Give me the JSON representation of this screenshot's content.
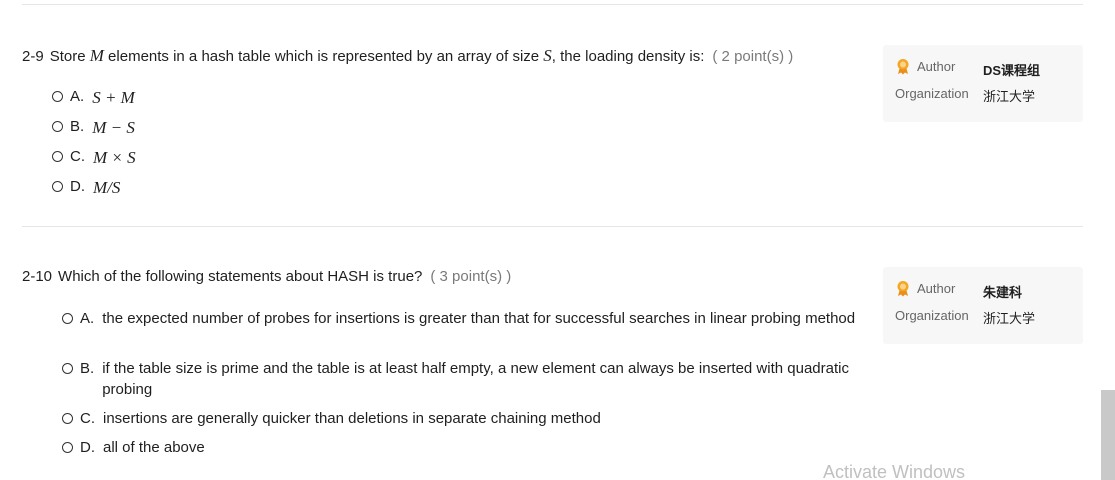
{
  "questions": [
    {
      "number": "2-9",
      "stem_before": "Store ",
      "stem_math1": "M",
      "stem_middle": " elements in a hash table which is represented by an array of size ",
      "stem_math2": "S",
      "stem_after": ", the loading density is:",
      "points": "( 2 point(s) )",
      "options": [
        {
          "letter": "A.",
          "text": "S + M"
        },
        {
          "letter": "B.",
          "text": "M − S"
        },
        {
          "letter": "C.",
          "text": "M × S"
        },
        {
          "letter": "D.",
          "text": "M/S"
        }
      ],
      "author_label": "Author",
      "author": "DS课程组",
      "org_label": "Organization",
      "org": "浙江大学"
    },
    {
      "number": "2-10",
      "stem": "Which of the following statements about HASH is true?",
      "points": "( 3 point(s) )",
      "options": [
        {
          "letter": "A.",
          "text": "the expected number of probes for insertions is greater than that for successful searches in linear probing method"
        },
        {
          "letter": "B.",
          "text": "if the table size is prime and the table is at least half empty, a new element can always be inserted with quadratic probing"
        },
        {
          "letter": "C.",
          "text": "insertions are generally quicker than deletions in separate chaining method"
        },
        {
          "letter": "D.",
          "text": "all of the above"
        }
      ],
      "author_label": "Author",
      "author": "朱建科",
      "org_label": "Organization",
      "org": "浙江大学"
    }
  ],
  "watermark": "Activate Windows",
  "colors": {
    "text": "#1f1f1f",
    "muted": "#7a7a7a",
    "card_bg": "#f7f7f7",
    "medal": "#f5a623"
  }
}
